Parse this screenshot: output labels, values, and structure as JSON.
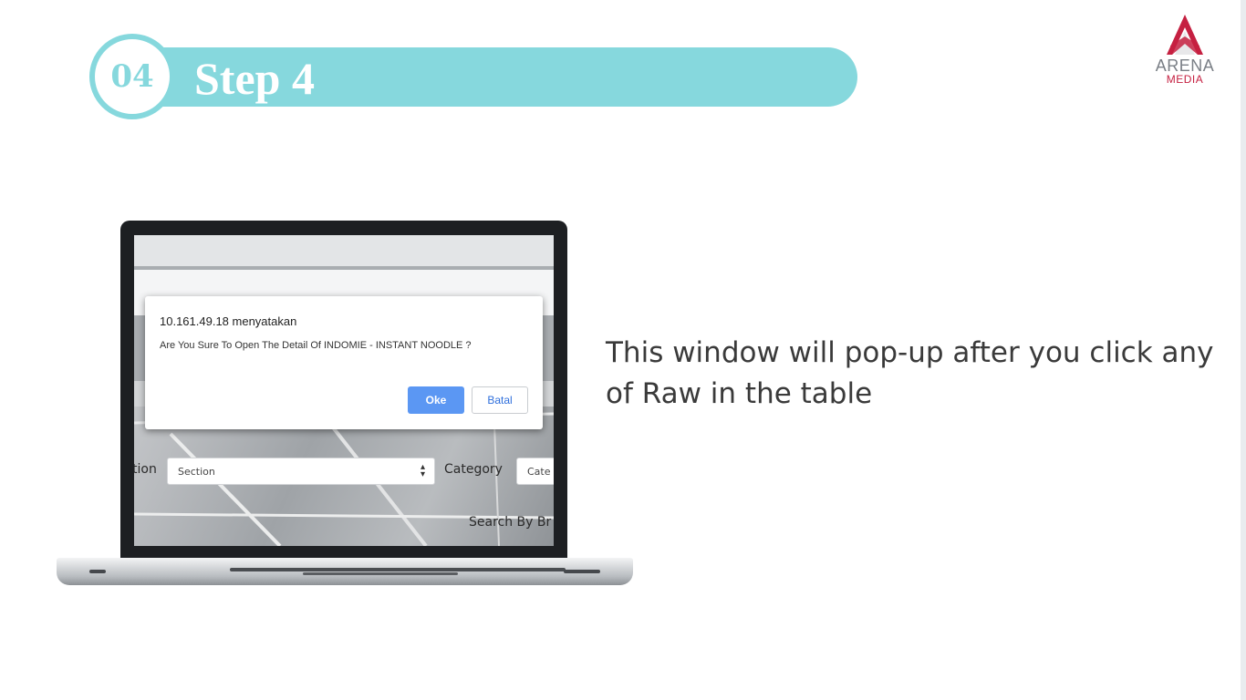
{
  "header": {
    "step_number": "04",
    "step_title": "Step 4"
  },
  "logo": {
    "line1": "ARENA",
    "line2": "MEDIA",
    "accent_color": "#c52041"
  },
  "dialog": {
    "origin": "10.161.49.18 menyatakan",
    "message": "Are You Sure To Open The Detail Of INDOMIE - INSTANT NOODLE ?",
    "ok_label": "Oke",
    "cancel_label": "Batal"
  },
  "form": {
    "section_label_partial": "tion",
    "section_select_value": "Section",
    "category_label": "Category",
    "category_select_partial": "Cate",
    "search_label_partial": "Search By Br"
  },
  "description": "This window will pop-up after you click any of Raw in the table",
  "colors": {
    "banner": "#86d8dd",
    "ok_button": "#5b97f3"
  }
}
